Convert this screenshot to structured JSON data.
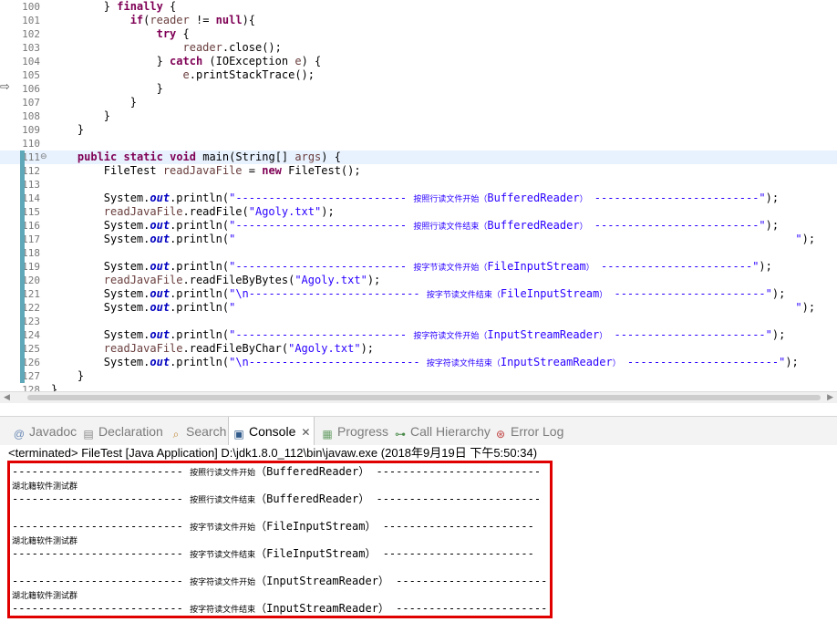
{
  "editor": {
    "lines": [
      {
        "n": "100",
        "code": "        } finally {"
      },
      {
        "n": "101",
        "code": "            if(reader != null){"
      },
      {
        "n": "102",
        "code": "                try {"
      },
      {
        "n": "103",
        "code": "                    reader.close();"
      },
      {
        "n": "104",
        "code": "                } catch (IOException e) {"
      },
      {
        "n": "105",
        "code": "                    e.printStackTrace();"
      },
      {
        "n": "106",
        "code": "                }"
      },
      {
        "n": "107",
        "code": "            }"
      },
      {
        "n": "108",
        "code": "        }"
      },
      {
        "n": "109",
        "code": "    }"
      },
      {
        "n": "110",
        "code": ""
      },
      {
        "n": "111",
        "code": "    public static void main(String[] args) {"
      },
      {
        "n": "112",
        "code": "        FileTest readJavaFile = new FileTest();"
      },
      {
        "n": "113",
        "code": ""
      },
      {
        "n": "114",
        "code": "        System.out.println(\"-------------------------- 按照行读文件开始（BufferedReader） -------------------------\");"
      },
      {
        "n": "115",
        "code": "        readJavaFile.readFile(\"Agoly.txt\");"
      },
      {
        "n": "116",
        "code": "        System.out.println(\"-------------------------- 按照行读文件结束（BufferedReader） -------------------------\");"
      },
      {
        "n": "117",
        "code": "        System.out.println(\"                                                                                     \");"
      },
      {
        "n": "118",
        "code": ""
      },
      {
        "n": "119",
        "code": "        System.out.println(\"-------------------------- 按字节读文件开始（FileInputStream） -----------------------\");"
      },
      {
        "n": "120",
        "code": "        readJavaFile.readFileByBytes(\"Agoly.txt\");"
      },
      {
        "n": "121",
        "code": "        System.out.println(\"\\n-------------------------- 按字节读文件结束（FileInputStream） -----------------------\");"
      },
      {
        "n": "122",
        "code": "        System.out.println(\"                                                                                     \");"
      },
      {
        "n": "123",
        "code": ""
      },
      {
        "n": "124",
        "code": "        System.out.println(\"-------------------------- 按字符读文件开始（InputStreamReader） -----------------------\");"
      },
      {
        "n": "125",
        "code": "        readJavaFile.readFileByChar(\"Agoly.txt\");"
      },
      {
        "n": "126",
        "code": "        System.out.println(\"\\n-------------------------- 按字符读文件结束（InputStreamReader） -----------------------\");"
      },
      {
        "n": "127",
        "code": "    }"
      },
      {
        "n": "128",
        "code": "}"
      }
    ]
  },
  "tabs": [
    {
      "label": "Javadoc",
      "icon": "at-icon"
    },
    {
      "label": "Declaration",
      "icon": "declaration-icon"
    },
    {
      "label": "Search",
      "icon": "search-icon"
    },
    {
      "label": "Console",
      "icon": "console-icon",
      "active": true
    },
    {
      "label": "Progress",
      "icon": "progress-icon"
    },
    {
      "label": "Call Hierarchy",
      "icon": "call-hierarchy-icon"
    },
    {
      "label": "Error Log",
      "icon": "error-log-icon"
    }
  ],
  "console": {
    "status": "<terminated> FileTest [Java Application] D:\\jdk1.8.0_112\\bin\\javaw.exe (2018年9月19日 下午5:50:34)",
    "lines": [
      {
        "dashes": "-------------------------- ",
        "cjk": "按照行读文件开始",
        "rest": "（BufferedReader） -------------------------"
      },
      {
        "cjk": "湖北籍软件测试群"
      },
      {
        "dashes": "-------------------------- ",
        "cjk": "按照行读文件结束",
        "rest": "（BufferedReader） -------------------------"
      },
      {
        "text": ""
      },
      {
        "dashes": "-------------------------- ",
        "cjk": "按字节读文件开始",
        "rest": "（FileInputStream） -----------------------"
      },
      {
        "cjk": "湖北籍软件测试群"
      },
      {
        "dashes": "-------------------------- ",
        "cjk": "按字节读文件结束",
        "rest": "（FileInputStream） -----------------------"
      },
      {
        "text": ""
      },
      {
        "dashes": "-------------------------- ",
        "cjk": "按字符读文件开始",
        "rest": "（InputStreamReader） -----------------------"
      },
      {
        "cjk": "湖北籍软件测试群"
      },
      {
        "dashes": "-------------------------- ",
        "cjk": "按字符读文件结束",
        "rest": "（InputStreamReader） -----------------------"
      }
    ]
  },
  "colors": {
    "keyword": "#7f0055",
    "string": "#2a00ff",
    "field": "#0000c0",
    "highlight_box": "#e00000",
    "current_line": "#e8f2fe"
  }
}
